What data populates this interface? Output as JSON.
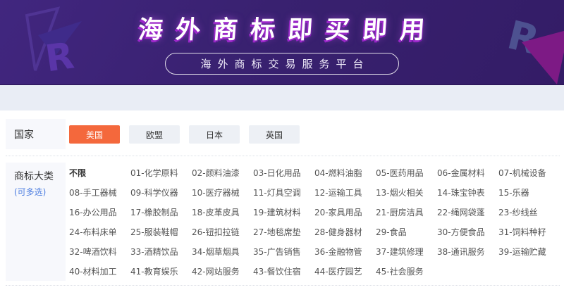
{
  "banner": {
    "title": "海外商标即买即用",
    "subtitle": "海外商标交易服务平台",
    "logo_letter": "R",
    "colors": {
      "banner_bg": "#392170",
      "title_glow": "#9B27C9",
      "logo_magenta": "#7D1A85"
    }
  },
  "filters": {
    "country": {
      "label": "国家",
      "selected": "美国",
      "options": [
        "美国",
        "欧盟",
        "日本",
        "英国"
      ]
    },
    "category": {
      "label": "商标大类",
      "hint": "(可多选)",
      "options": [
        "不限",
        "01-化学原料",
        "02-颜料油漆",
        "03-日化用品",
        "04-燃料油脂",
        "05-医药用品",
        "06-金属材料",
        "07-机械设备",
        "08-手工器械",
        "09-科学仪器",
        "10-医疗器械",
        "11-灯具空调",
        "12-运输工具",
        "13-烟火相关",
        "14-珠宝钟表",
        "15-乐器",
        "16-办公用品",
        "17-橡胶制品",
        "18-皮革皮具",
        "19-建筑材料",
        "20-家具用品",
        "21-厨房洁具",
        "22-绳网袋蓬",
        "23-纱线丝",
        "24-布料床单",
        "25-服装鞋帽",
        "26-钮扣拉链",
        "27-地毯席垫",
        "28-健身器材",
        "29-食品",
        "30-方便食品",
        "31-饲料种籽",
        "32-啤酒饮料",
        "33-酒精饮品",
        "34-烟草烟具",
        "35-广告销售",
        "36-金融物管",
        "37-建筑修理",
        "38-通讯服务",
        "39-运输贮藏",
        "40-材料加工",
        "41-教育娱乐",
        "42-网站服务",
        "43-餐饮住宿",
        "44-医疗园艺",
        "45-社会服务"
      ]
    }
  },
  "colors": {
    "accent_orange": "#F4683C",
    "page_bg": "#E9EDF5",
    "link_blue": "#4A7BDF"
  }
}
